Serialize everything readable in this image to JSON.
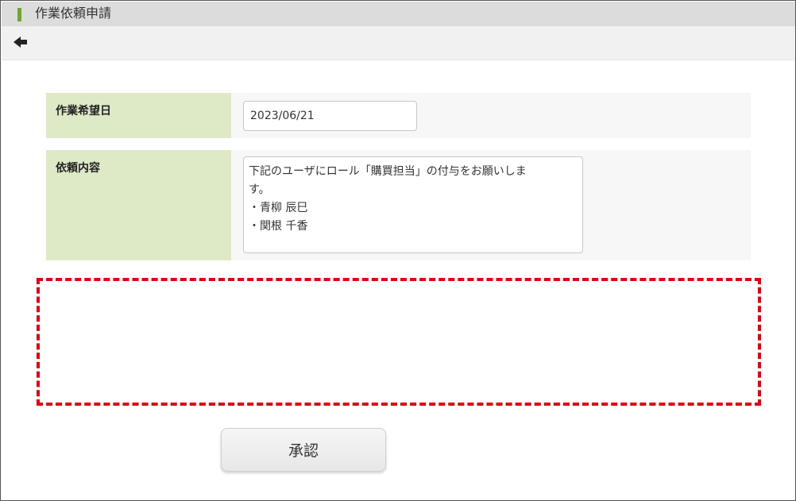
{
  "window": {
    "title": "作業依頼申請",
    "accent_color": "#6ba82c"
  },
  "toolbar": {
    "back_icon": "arrow-left-icon"
  },
  "form": {
    "fields": [
      {
        "label": "作業希望日",
        "value": "2023/06/21"
      },
      {
        "label": "依頼内容",
        "lines": [
          "下記のユーザにロール「購買担当」の付与をお願いしま",
          "す。",
          "・青柳 辰巳",
          "・関根 千香"
        ]
      }
    ],
    "label_background": "#deeac6",
    "highlight_border_color": "#e50012"
  },
  "actions": {
    "approve_label": "承認"
  }
}
